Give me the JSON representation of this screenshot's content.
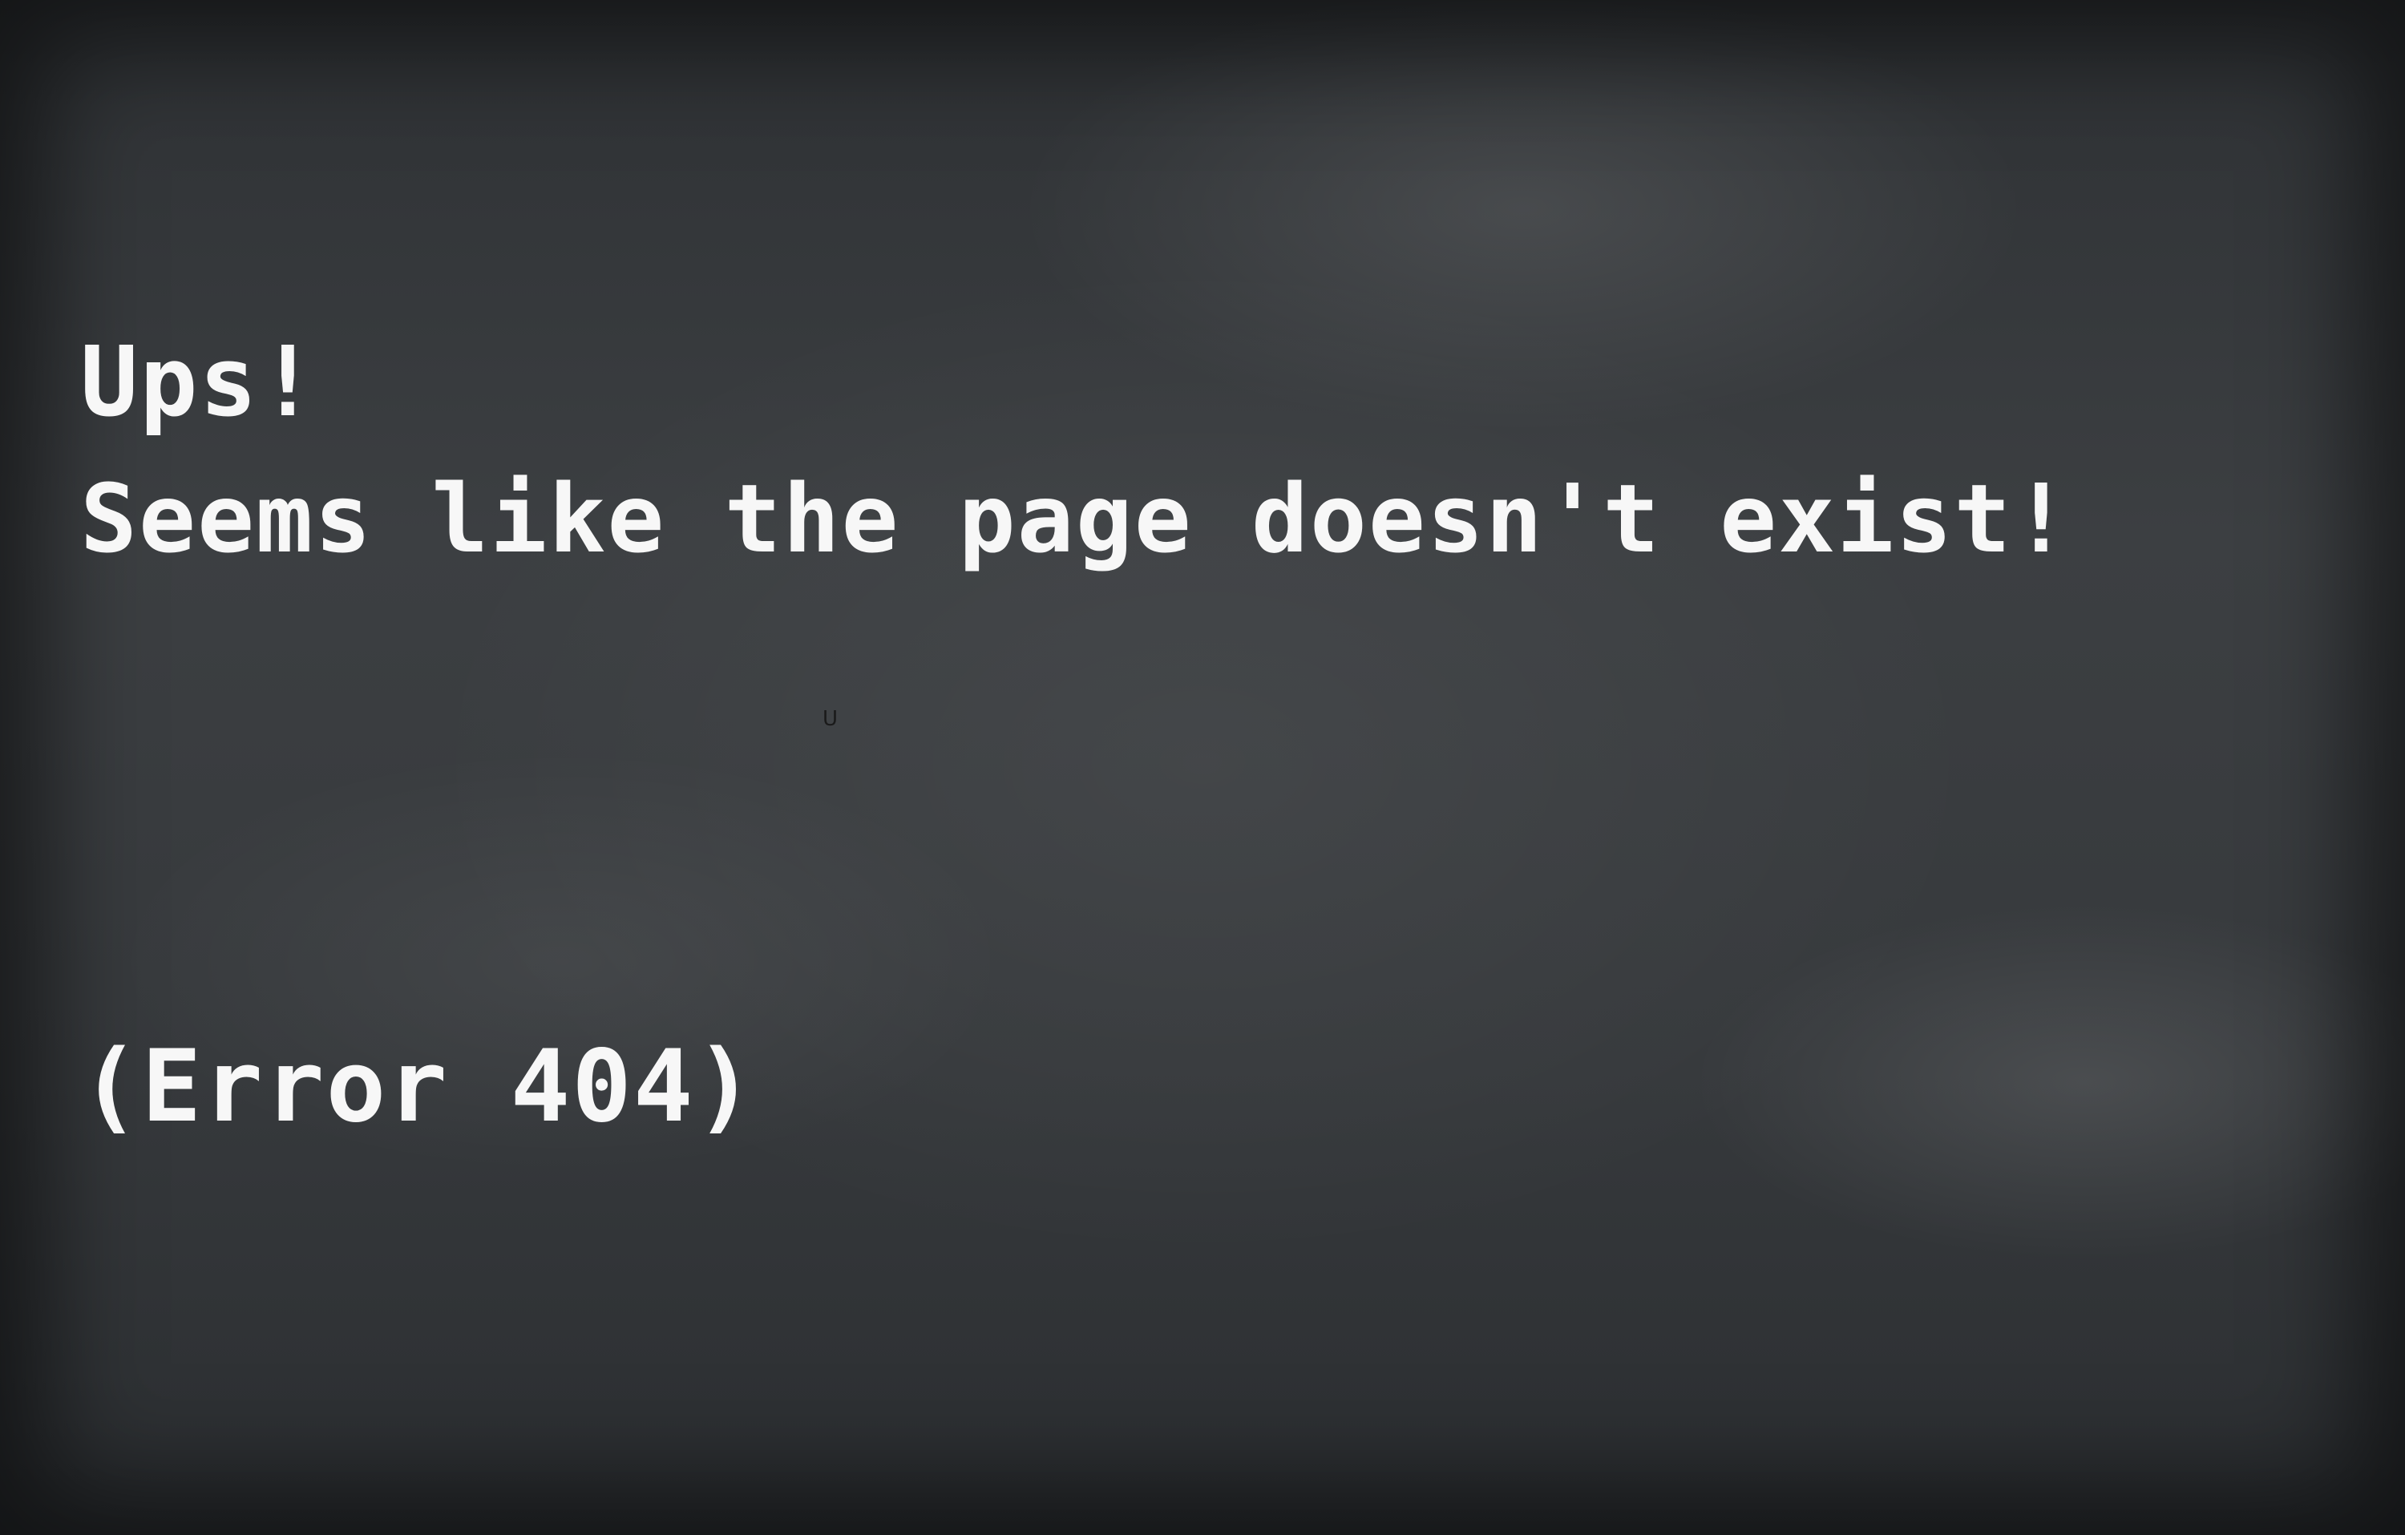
{
  "error_page": {
    "heading": "Ups!",
    "message": "Seems like the page doesn't exist!",
    "stray_char": "U",
    "error_code": "(Error 404)"
  },
  "colors": {
    "background": "#3b3e41",
    "text": "#f7f7f7"
  }
}
